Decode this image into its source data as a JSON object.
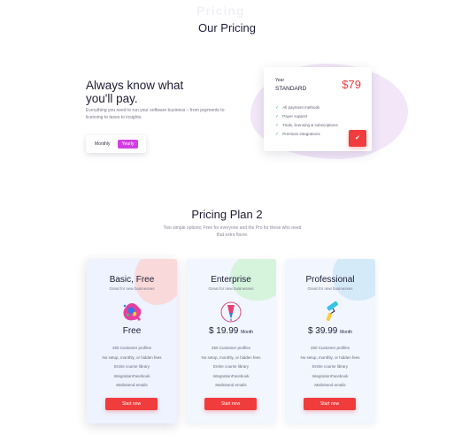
{
  "watermark": "Pricing",
  "hero": {
    "section_title": "Our Pricing",
    "headline": "Always know what you'll pay.",
    "description": "Everything you need to run your software business – from payments to licensing to taxes to insights.",
    "toggle": {
      "monthly_label": "Monthly",
      "yearly_label": "Yearly",
      "selected": "Yearly"
    }
  },
  "standard_card": {
    "period": "Year",
    "name": "STANDARD",
    "price": "$79",
    "features": [
      "All payment methods",
      "Payer support",
      "Trials, licensing & subscriptions",
      "Premium integrations"
    ],
    "button_icon": "check-icon"
  },
  "plans_section": {
    "title": "Pricing Plan 2",
    "subtitle": "Two simple options; Free for everyone and the Pro for these who need that extra flavor."
  },
  "plans": [
    {
      "name": "Basic, Free",
      "tagline": "Great for new businesses",
      "icon": "paint-splash-icon",
      "price": "Free",
      "period": "",
      "features": [
        "250 Customer profiles",
        "No setup, monthly, or hidden fees",
        "Entire course library",
        "IntegrationFacebook",
        "MailsSend emails"
      ],
      "button": "Start now"
    },
    {
      "name": "Enterprise",
      "tagline": "Great for new businesses",
      "icon": "pen-icon",
      "price": "$ 19.99",
      "period": "Month",
      "features": [
        "250 Customer profiles",
        "No setup, monthly, or hidden fees",
        "Entire course library",
        "IntegrationFacebook",
        "MailsSend emails"
      ],
      "button": "Start now"
    },
    {
      "name": "Professional",
      "tagline": "Great for new businesses",
      "icon": "paint-roller-icon",
      "price": "$ 39.99",
      "period": "Month",
      "features": [
        "250 Customer profiles",
        "No setup, monthly, or hidden fees",
        "Entire course library",
        "IntegrationFacebook",
        "MailsSend emails"
      ],
      "button": "Start now"
    }
  ],
  "colors": {
    "accent_red": "#f03c3c",
    "toggle_purple": "#d040e0",
    "check_green": "#38b88a",
    "heading": "#1d1d35"
  }
}
